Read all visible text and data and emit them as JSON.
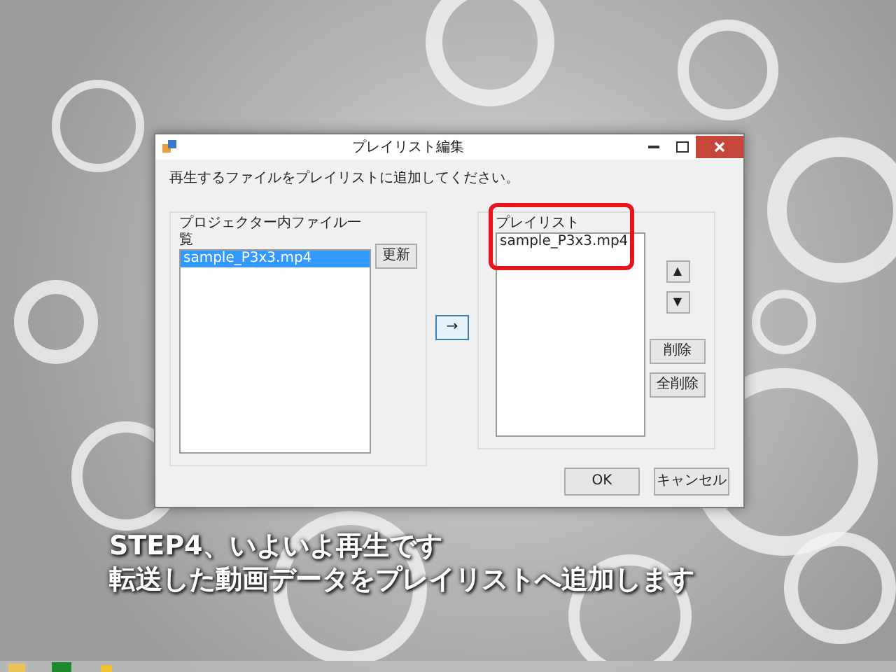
{
  "window": {
    "title": "プレイリスト編集",
    "instruction": "再生するファイルをプレイリストに追加してください。"
  },
  "source": {
    "label": "プロジェクター内ファイル一覧",
    "items": [
      {
        "text": "sample_P3x3.mp4",
        "selected": true
      }
    ],
    "refresh_button": "更新"
  },
  "add_button": "→",
  "playlist": {
    "label": "プレイリスト",
    "highlighted": true,
    "items": [
      {
        "text": "sample_P3x3.mp4",
        "selected": false
      }
    ],
    "buttons": [
      {
        "label": "▲",
        "kind": "move"
      },
      {
        "label": "▼",
        "kind": "move"
      },
      {
        "label": "削除",
        "kind": "action"
      },
      {
        "label": "全削除",
        "kind": "action"
      }
    ]
  },
  "dialog_buttons": [
    "OK",
    "キャンセル"
  ],
  "caption": [
    "STEP4、いよいよ再生です",
    "転送した動画データをプレイリストへ追加します"
  ]
}
